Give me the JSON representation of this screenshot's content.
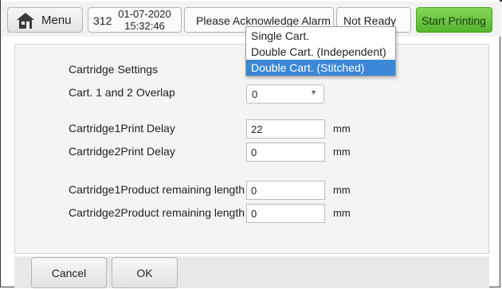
{
  "header": {
    "menu_label": "Menu",
    "print_count": "312",
    "date": "01-07-2020",
    "time": "15:32:46",
    "alarm_message": "Please Acknowledge Alarm",
    "status": "Not Ready",
    "start_label": "Start Printing"
  },
  "settings": {
    "section_title": "Cartridge Settings",
    "overlap_label": "Cart. 1 and 2 Overlap",
    "overlap_value": "0",
    "cart1_delay_label": "Cartridge1Print Delay",
    "cart1_delay_value": "22",
    "cart2_delay_label": "Cartridge2Print Delay",
    "cart2_delay_value": "0",
    "cart1_remaining_label": "Cartridge1Product remaining length",
    "cart1_remaining_value": "0",
    "cart2_remaining_label": "Cartridge2Product remaining length",
    "cart2_remaining_value": "0",
    "unit": "mm"
  },
  "dropdown": {
    "options": [
      "Single Cart.",
      "Double Cart. (Independent)",
      "Double Cart. (Stitched)"
    ],
    "selected": "Double Cart. (Stitched)"
  },
  "footer": {
    "cancel_label": "Cancel",
    "ok_label": "OK"
  },
  "colors": {
    "start_button": "#5cb833",
    "selected_option": "#3b87d6"
  },
  "icons": {
    "menu": "home-icon",
    "select_caret": "caret-down-icon"
  }
}
